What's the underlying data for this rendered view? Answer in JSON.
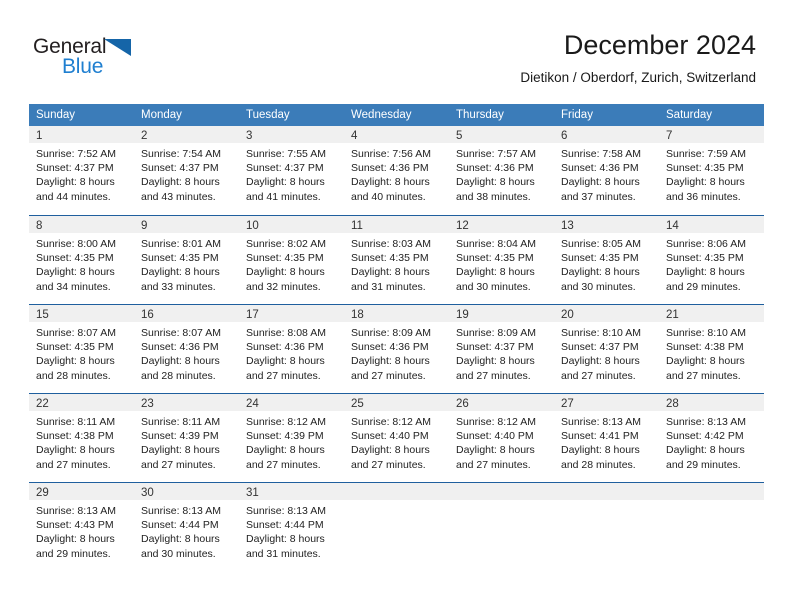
{
  "brand": {
    "name_top": "General",
    "name_bottom": "Blue",
    "color_dark": "#231f20",
    "color_blue": "#1f7fd0",
    "triangle_color": "#1565a8"
  },
  "header": {
    "title": "December 2024",
    "subtitle": "Dietikon / Oberdorf, Zurich, Switzerland"
  },
  "theme": {
    "header_bar": "#3b7cb9",
    "row_divider": "#1f5f9e",
    "day_band": "#f0f0f0",
    "text": "#222222"
  },
  "weekdays": [
    "Sunday",
    "Monday",
    "Tuesday",
    "Wednesday",
    "Thursday",
    "Friday",
    "Saturday"
  ],
  "weeks": [
    [
      {
        "day": "1",
        "sunrise": "Sunrise: 7:52 AM",
        "sunset": "Sunset: 4:37 PM",
        "daylight1": "Daylight: 8 hours",
        "daylight2": "and 44 minutes."
      },
      {
        "day": "2",
        "sunrise": "Sunrise: 7:54 AM",
        "sunset": "Sunset: 4:37 PM",
        "daylight1": "Daylight: 8 hours",
        "daylight2": "and 43 minutes."
      },
      {
        "day": "3",
        "sunrise": "Sunrise: 7:55 AM",
        "sunset": "Sunset: 4:37 PM",
        "daylight1": "Daylight: 8 hours",
        "daylight2": "and 41 minutes."
      },
      {
        "day": "4",
        "sunrise": "Sunrise: 7:56 AM",
        "sunset": "Sunset: 4:36 PM",
        "daylight1": "Daylight: 8 hours",
        "daylight2": "and 40 minutes."
      },
      {
        "day": "5",
        "sunrise": "Sunrise: 7:57 AM",
        "sunset": "Sunset: 4:36 PM",
        "daylight1": "Daylight: 8 hours",
        "daylight2": "and 38 minutes."
      },
      {
        "day": "6",
        "sunrise": "Sunrise: 7:58 AM",
        "sunset": "Sunset: 4:36 PM",
        "daylight1": "Daylight: 8 hours",
        "daylight2": "and 37 minutes."
      },
      {
        "day": "7",
        "sunrise": "Sunrise: 7:59 AM",
        "sunset": "Sunset: 4:35 PM",
        "daylight1": "Daylight: 8 hours",
        "daylight2": "and 36 minutes."
      }
    ],
    [
      {
        "day": "8",
        "sunrise": "Sunrise: 8:00 AM",
        "sunset": "Sunset: 4:35 PM",
        "daylight1": "Daylight: 8 hours",
        "daylight2": "and 34 minutes."
      },
      {
        "day": "9",
        "sunrise": "Sunrise: 8:01 AM",
        "sunset": "Sunset: 4:35 PM",
        "daylight1": "Daylight: 8 hours",
        "daylight2": "and 33 minutes."
      },
      {
        "day": "10",
        "sunrise": "Sunrise: 8:02 AM",
        "sunset": "Sunset: 4:35 PM",
        "daylight1": "Daylight: 8 hours",
        "daylight2": "and 32 minutes."
      },
      {
        "day": "11",
        "sunrise": "Sunrise: 8:03 AM",
        "sunset": "Sunset: 4:35 PM",
        "daylight1": "Daylight: 8 hours",
        "daylight2": "and 31 minutes."
      },
      {
        "day": "12",
        "sunrise": "Sunrise: 8:04 AM",
        "sunset": "Sunset: 4:35 PM",
        "daylight1": "Daylight: 8 hours",
        "daylight2": "and 30 minutes."
      },
      {
        "day": "13",
        "sunrise": "Sunrise: 8:05 AM",
        "sunset": "Sunset: 4:35 PM",
        "daylight1": "Daylight: 8 hours",
        "daylight2": "and 30 minutes."
      },
      {
        "day": "14",
        "sunrise": "Sunrise: 8:06 AM",
        "sunset": "Sunset: 4:35 PM",
        "daylight1": "Daylight: 8 hours",
        "daylight2": "and 29 minutes."
      }
    ],
    [
      {
        "day": "15",
        "sunrise": "Sunrise: 8:07 AM",
        "sunset": "Sunset: 4:35 PM",
        "daylight1": "Daylight: 8 hours",
        "daylight2": "and 28 minutes."
      },
      {
        "day": "16",
        "sunrise": "Sunrise: 8:07 AM",
        "sunset": "Sunset: 4:36 PM",
        "daylight1": "Daylight: 8 hours",
        "daylight2": "and 28 minutes."
      },
      {
        "day": "17",
        "sunrise": "Sunrise: 8:08 AM",
        "sunset": "Sunset: 4:36 PM",
        "daylight1": "Daylight: 8 hours",
        "daylight2": "and 27 minutes."
      },
      {
        "day": "18",
        "sunrise": "Sunrise: 8:09 AM",
        "sunset": "Sunset: 4:36 PM",
        "daylight1": "Daylight: 8 hours",
        "daylight2": "and 27 minutes."
      },
      {
        "day": "19",
        "sunrise": "Sunrise: 8:09 AM",
        "sunset": "Sunset: 4:37 PM",
        "daylight1": "Daylight: 8 hours",
        "daylight2": "and 27 minutes."
      },
      {
        "day": "20",
        "sunrise": "Sunrise: 8:10 AM",
        "sunset": "Sunset: 4:37 PM",
        "daylight1": "Daylight: 8 hours",
        "daylight2": "and 27 minutes."
      },
      {
        "day": "21",
        "sunrise": "Sunrise: 8:10 AM",
        "sunset": "Sunset: 4:38 PM",
        "daylight1": "Daylight: 8 hours",
        "daylight2": "and 27 minutes."
      }
    ],
    [
      {
        "day": "22",
        "sunrise": "Sunrise: 8:11 AM",
        "sunset": "Sunset: 4:38 PM",
        "daylight1": "Daylight: 8 hours",
        "daylight2": "and 27 minutes."
      },
      {
        "day": "23",
        "sunrise": "Sunrise: 8:11 AM",
        "sunset": "Sunset: 4:39 PM",
        "daylight1": "Daylight: 8 hours",
        "daylight2": "and 27 minutes."
      },
      {
        "day": "24",
        "sunrise": "Sunrise: 8:12 AM",
        "sunset": "Sunset: 4:39 PM",
        "daylight1": "Daylight: 8 hours",
        "daylight2": "and 27 minutes."
      },
      {
        "day": "25",
        "sunrise": "Sunrise: 8:12 AM",
        "sunset": "Sunset: 4:40 PM",
        "daylight1": "Daylight: 8 hours",
        "daylight2": "and 27 minutes."
      },
      {
        "day": "26",
        "sunrise": "Sunrise: 8:12 AM",
        "sunset": "Sunset: 4:40 PM",
        "daylight1": "Daylight: 8 hours",
        "daylight2": "and 27 minutes."
      },
      {
        "day": "27",
        "sunrise": "Sunrise: 8:13 AM",
        "sunset": "Sunset: 4:41 PM",
        "daylight1": "Daylight: 8 hours",
        "daylight2": "and 28 minutes."
      },
      {
        "day": "28",
        "sunrise": "Sunrise: 8:13 AM",
        "sunset": "Sunset: 4:42 PM",
        "daylight1": "Daylight: 8 hours",
        "daylight2": "and 29 minutes."
      }
    ],
    [
      {
        "day": "29",
        "sunrise": "Sunrise: 8:13 AM",
        "sunset": "Sunset: 4:43 PM",
        "daylight1": "Daylight: 8 hours",
        "daylight2": "and 29 minutes."
      },
      {
        "day": "30",
        "sunrise": "Sunrise: 8:13 AM",
        "sunset": "Sunset: 4:44 PM",
        "daylight1": "Daylight: 8 hours",
        "daylight2": "and 30 minutes."
      },
      {
        "day": "31",
        "sunrise": "Sunrise: 8:13 AM",
        "sunset": "Sunset: 4:44 PM",
        "daylight1": "Daylight: 8 hours",
        "daylight2": "and 31 minutes."
      },
      {
        "day": "",
        "sunrise": "",
        "sunset": "",
        "daylight1": "",
        "daylight2": ""
      },
      {
        "day": "",
        "sunrise": "",
        "sunset": "",
        "daylight1": "",
        "daylight2": ""
      },
      {
        "day": "",
        "sunrise": "",
        "sunset": "",
        "daylight1": "",
        "daylight2": ""
      },
      {
        "day": "",
        "sunrise": "",
        "sunset": "",
        "daylight1": "",
        "daylight2": ""
      }
    ]
  ]
}
